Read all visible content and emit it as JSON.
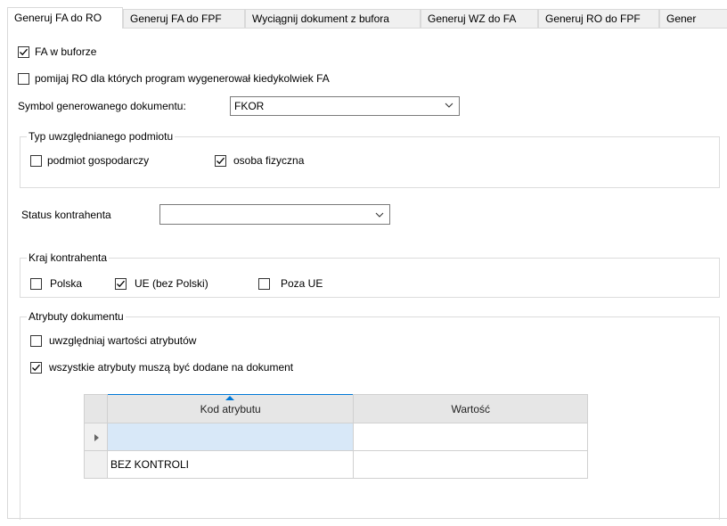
{
  "tabs": [
    {
      "label": "Generuj FA do RO",
      "active": true
    },
    {
      "label": "Generuj FA do FPF",
      "active": false
    },
    {
      "label": "Wyciągnij dokument z bufora",
      "active": false
    },
    {
      "label": "Generuj WZ do FA",
      "active": false
    },
    {
      "label": "Generuj RO do FPF",
      "active": false
    },
    {
      "label": "Gener",
      "active": false
    }
  ],
  "options": {
    "fa_w_buforze": {
      "label": "FA w buforze",
      "checked": true
    },
    "pomijaj_ro": {
      "label": "pomijaj RO dla których program wygenerował kiedykolwiek FA",
      "checked": false
    }
  },
  "symbol": {
    "label": "Symbol generowanego dokumentu:",
    "value": "FKOR"
  },
  "typ_podmiotu": {
    "legend": "Typ uwzględnianego podmiotu",
    "podmiot": {
      "label": "podmiot gospodarczy",
      "checked": false
    },
    "osoba": {
      "label": "osoba fizyczna",
      "checked": true
    }
  },
  "status": {
    "label": "Status kontrahenta",
    "value": ""
  },
  "kraj": {
    "legend": "Kraj kontrahenta",
    "polska": {
      "label": "Polska",
      "checked": false
    },
    "ue": {
      "label": "UE (bez Polski)",
      "checked": true
    },
    "poza": {
      "label": "Poza UE",
      "checked": false
    }
  },
  "atrybuty": {
    "legend": "Atrybuty dokumentu",
    "uwzgledniaj": {
      "label": "uwzględniaj wartości atrybutów",
      "checked": false
    },
    "wszystkie": {
      "label": "wszystkie atrybuty muszą być dodane na dokument",
      "checked": true
    },
    "grid": {
      "columns": [
        "Kod atrybutu",
        "Wartość"
      ],
      "rows": [
        {
          "kod": "",
          "wartosc": "",
          "current": true
        },
        {
          "kod": "BEZ KONTROLI",
          "wartosc": "",
          "current": false
        }
      ]
    }
  },
  "colors": {
    "accent": "#0078d7",
    "border": "#d9d9d9",
    "grid_header": "#e6e6e6"
  }
}
